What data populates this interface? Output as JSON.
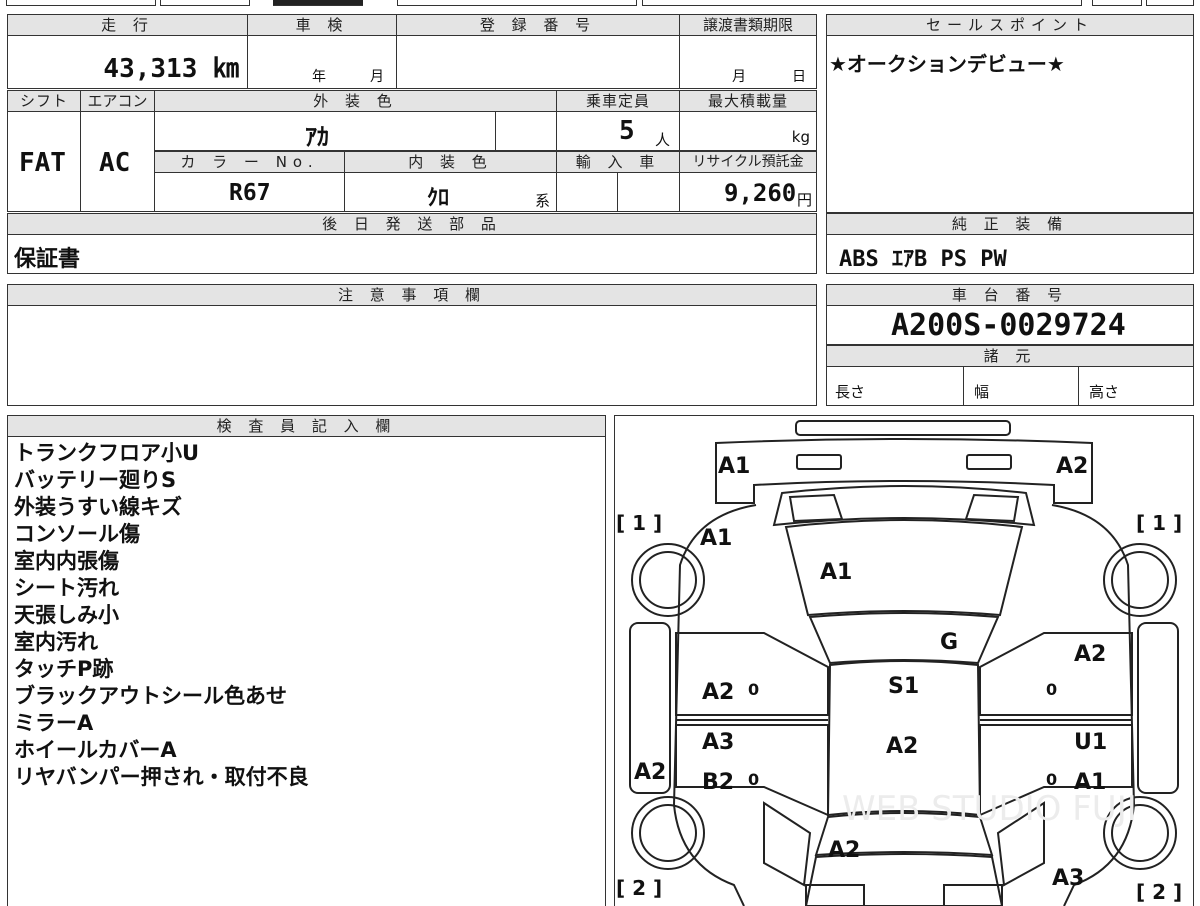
{
  "top_strip": {
    "partial_text": ""
  },
  "vehicle": {
    "mileage_label": "走 行",
    "mileage": "43,313 ㎞",
    "shaken_label": "車 検",
    "shaken_year_unit": "年",
    "shaken_month_unit": "月",
    "registration_label": "登 録 番 号",
    "transfer_label": "譲渡書類期限",
    "transfer_month_unit": "月",
    "transfer_day_unit": "日",
    "shift_label": "シフト",
    "shift": "FAT",
    "aircon_label": "エアコン",
    "aircon": "AC",
    "exterior_label": "外 装 色",
    "exterior": "ｱｶ",
    "capacity_label": "乗車定員",
    "capacity": "5",
    "capacity_unit": "人",
    "maxload_label": "最大積載量",
    "maxload_unit": "kg",
    "colorno_label": "カ ラ ー No.",
    "colorno": "R67",
    "interior_label": "内 装 色",
    "interior": "ｸﾛ",
    "interior_suffix": "系",
    "import_label": "輸 入 車",
    "recycle_label": "リサイクル預託金",
    "recycle": "9,260",
    "recycle_unit": "円"
  },
  "sales_point": {
    "label": "セールスポイント",
    "text": "★オークションデビュー★"
  },
  "later_parts": {
    "label": "後 日 発 送 部 品",
    "text": "保証書"
  },
  "equipment": {
    "label": "純 正 装 備",
    "text": "ABS  ｴｱB  PS  PW"
  },
  "notes": {
    "label": "注 意 事 項 欄",
    "text": ""
  },
  "chassis": {
    "label": "車 台 番 号",
    "number": "A200S-0029724"
  },
  "specs": {
    "label": "諸 元",
    "length": "長さ",
    "width": "幅",
    "height": "高さ"
  },
  "inspector": {
    "label": "検 査 員 記 入 欄",
    "lines": [
      "トランクフロア小U",
      "バッテリー廻りS",
      "外装うすい線キズ",
      "コンソール傷",
      "室内内張傷",
      "シート汚れ",
      "天張しみ小",
      "室内汚れ",
      "タッチP跡",
      "ブラックアウトシール色あせ",
      "ミラーA",
      "ホイールカバーA",
      "リヤバンパー押され・取付不良"
    ]
  },
  "diagram": {
    "bracket_1": "[ 1 ]",
    "bracket_2": "[ 2 ]",
    "marks": {
      "front_left": "A1",
      "front_right": "A2",
      "fender_left": "A1",
      "hood": "A1",
      "windshield_g": "G",
      "door_fr_right": "A2",
      "door_fl_left": "A2",
      "roof": "S1",
      "door_rl_left_top": "A3",
      "door_rl_left_bottom": "B2",
      "door_rr_right_top": "U1",
      "door_rr_right_bottom": "A1",
      "side_left": "A2",
      "center": "A2",
      "trunk": "A2",
      "rear_right": "A3",
      "zero_1": "0",
      "zero_2": "0",
      "zero_3": "0",
      "zero_4": "0"
    },
    "watermark": "WEB STUDIO FUJI"
  }
}
